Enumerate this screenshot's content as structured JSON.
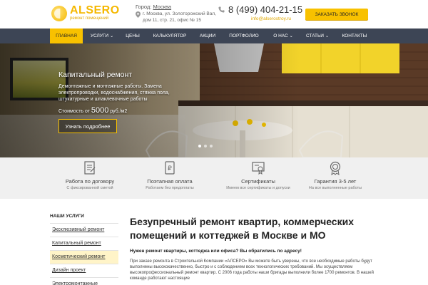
{
  "header": {
    "logo_name": "ALSERO",
    "logo_sub": "ремонт помещений",
    "city_label": "Город:",
    "city": "Москва",
    "address_line1": "г. Москва, ул. Золоторожский Вал,",
    "address_line2": "дом 11, стр. 21, офис № 15",
    "phone": "8 (499) 404-21-15",
    "email": "info@alserostroy.ru",
    "callback_label": "ЗАКАЗАТЬ ЗВОНОК"
  },
  "nav": {
    "items": [
      {
        "label": "ГЛАВНАЯ",
        "active": true
      },
      {
        "label": "УСЛУГИ",
        "dropdown": true
      },
      {
        "label": "ЦЕНЫ"
      },
      {
        "label": "КАЛЬКУЛЯТОР"
      },
      {
        "label": "АКЦИИ"
      },
      {
        "label": "ПОРТФОЛИО"
      },
      {
        "label": "О НАС",
        "dropdown": true
      },
      {
        "label": "СТАТЬИ",
        "dropdown": true
      },
      {
        "label": "КОНТАКТЫ"
      }
    ]
  },
  "hero": {
    "title": "Капитальный ремонт",
    "description": "Демонтажные и монтажные работы. Замена электропроводки, водоснабжения, стяжка пола, штукатурные и шпаклевочные работы",
    "price_prefix": "Стоимость от",
    "price_value": "5000",
    "price_unit": "руб./м2",
    "button_label": "Узнать подробнее",
    "slides_total": 3,
    "active_slide": 1
  },
  "features": [
    {
      "title": "Работа по договору",
      "subtitle": "С фиксированной сметой",
      "icon": "contract-icon"
    },
    {
      "title": "Поэтапная оплата",
      "subtitle": "Работаем без предоплаты",
      "icon": "payment-icon"
    },
    {
      "title": "Сертификаты",
      "subtitle": "Имеем все сертификаты и допуски",
      "icon": "certificate-icon"
    },
    {
      "title": "Гарантия 3-5 лет",
      "subtitle": "На все выполненные работы",
      "icon": "guarantee-icon"
    }
  ],
  "sidebar": {
    "title": "НАШИ УСЛУГИ",
    "items": [
      {
        "label": "Эксклюзивный ремонт"
      },
      {
        "label": "Капитальный ремонт"
      },
      {
        "label": "Косметический ремонт",
        "highlighted": true
      },
      {
        "label": "Дизайн проект"
      },
      {
        "label": "Электромонтажные"
      }
    ]
  },
  "main": {
    "title": "Безупречный ремонт квартир, коммерческих помещений и коттеджей в Москве и МО",
    "question": "Нужен ремонт квартиры, коттеджа или офиса? Вы обратились по адресу!",
    "paragraph": "При заказе ремонта в Строительной Компании «АЛСЕРО» Вы можете быть уверены, что все необходимые работы будут выполнены высококачественно, быстро и с соблюдением всех технологических требований. Мы осуществляем высокопрофессиональный ремонт квартир. С 2006 года работы наши бригады выполнили более 1700 ремонтов. В нашей команде работают настоящие"
  },
  "colors": {
    "accent": "#f8c100",
    "nav_bg": "#3d4555",
    "feature_bg": "#f0f0f0"
  }
}
